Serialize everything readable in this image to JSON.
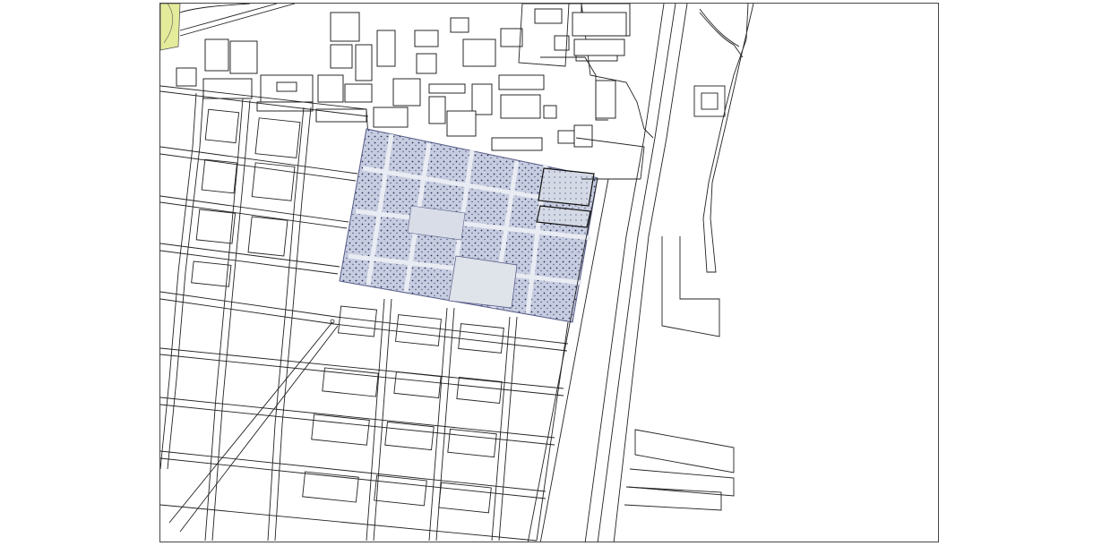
{
  "map": {
    "kind": "CAD site plan",
    "line_color": "#222222",
    "background": "#ffffff",
    "highlight_fill": "#c9cfe0",
    "corner_accent": "#d9e37a",
    "layers": [
      "street-blocks",
      "buildings",
      "landscaped-grid",
      "coastal-outline"
    ]
  }
}
